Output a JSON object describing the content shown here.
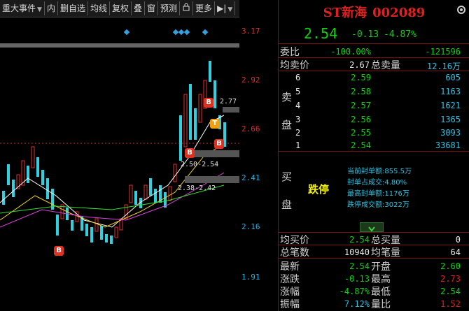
{
  "toolbar": {
    "items": [
      "重大事件",
      "内",
      "删自选",
      "均线",
      "复权",
      "叠",
      "窗",
      "预测",
      "更多"
    ]
  },
  "price_axis": [
    "3.17",
    "2.92",
    "2.66",
    "2.41",
    "2.16",
    "1.91"
  ],
  "chart_notes": {
    "n1": "2.77",
    "n2": "2.50-2.54",
    "n3": "2.38-2.42"
  },
  "markers": {
    "b": "B",
    "t": "T"
  },
  "stock": {
    "name": "ST新海",
    "code": "002089",
    "price": "2.54",
    "change": "-0.13",
    "pct": "-4.87%"
  },
  "weibi": {
    "label": "委比",
    "pct": "-100.00%",
    "diff": "-121596"
  },
  "avg_sell": {
    "label": "均卖价",
    "price": "2.67",
    "vol_label": "总卖量",
    "vol": "12.16万"
  },
  "sell_label": "卖盘",
  "sell": [
    {
      "lvl": "6",
      "price": "2.59",
      "vol": "605"
    },
    {
      "lvl": "5",
      "price": "2.58",
      "vol": "1163"
    },
    {
      "lvl": "4",
      "price": "2.57",
      "vol": "1621"
    },
    {
      "lvl": "3",
      "price": "2.56",
      "vol": "1365"
    },
    {
      "lvl": "2",
      "price": "2.55",
      "vol": "3093"
    },
    {
      "lvl": "1",
      "price": "2.54",
      "vol": "33681"
    }
  ],
  "buy_label": "买盘",
  "limit": {
    "status": "跌停",
    "seal_amount_label": "当前封单额:",
    "seal_amount": "855.5万",
    "seal_ratio_label": "封单占成交:",
    "seal_ratio": "4.80%",
    "max_seal_label": "最高封单额:",
    "max_seal": "1176万",
    "deal_label": "跌停成交额:",
    "deal": "3022万"
  },
  "avg_buy": {
    "label": "均买价",
    "price": "2.54",
    "vol_label": "总买量",
    "vol": "0"
  },
  "trades": {
    "label": "总笔数",
    "count": "10940",
    "avg_label": "均笔量",
    "avg": "64"
  },
  "stats": [
    {
      "l1": "最新",
      "v1": "2.54",
      "l2": "开盘",
      "v2": "2.60"
    },
    {
      "l1": "涨跌",
      "v1": "-0.13",
      "l2": "最高",
      "v2": "2.73"
    },
    {
      "l1": "涨幅",
      "v1": "-4.87%",
      "l2": "最低",
      "v2": "2.54"
    },
    {
      "l1": "振幅",
      "v1": "7.12%",
      "l2": "量比",
      "v2": "1.52"
    }
  ],
  "colors": {
    "up": "#e02020",
    "down": "#10d010",
    "cyan": "#30c0e0",
    "panel_border": "#7a1010"
  }
}
